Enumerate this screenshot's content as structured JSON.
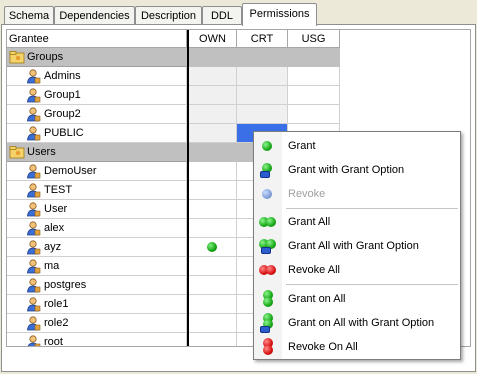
{
  "tabs": [
    {
      "label": "Schema",
      "active": false
    },
    {
      "label": "Dependencies",
      "active": false
    },
    {
      "label": "Description",
      "active": false
    },
    {
      "label": "DDL",
      "active": false
    },
    {
      "label": "Permissions",
      "active": true
    }
  ],
  "grid": {
    "columns": {
      "grantee": "Grantee",
      "own": "OWN",
      "crt": "CRT",
      "usg": "USG"
    },
    "groups_header": "Groups",
    "groups": [
      "Admins",
      "Group1",
      "Group2",
      "PUBLIC"
    ],
    "users_header": "Users",
    "users": [
      "DemoUser",
      "TEST",
      "User",
      "alex",
      "ayz",
      "ma",
      "postgres",
      "role1",
      "role2",
      "root"
    ],
    "granted_own_user": "ayz",
    "selected_cell": "PUBLIC / CRT"
  },
  "context_menu": {
    "items": [
      {
        "label": "Grant",
        "icon": "grant-icon",
        "enabled": true
      },
      {
        "label": "Grant with Grant Option",
        "icon": "grant-with-option-icon",
        "enabled": true
      },
      {
        "label": "Revoke",
        "icon": "revoke-icon",
        "enabled": false
      },
      {
        "label": "Grant All",
        "icon": "grant-all-icon",
        "enabled": true
      },
      {
        "label": "Grant All with Grant Option",
        "icon": "grant-all-with-option-icon",
        "enabled": true
      },
      {
        "label": "Revoke All",
        "icon": "revoke-all-icon",
        "enabled": true
      },
      {
        "label": "Grant on All",
        "icon": "grant-on-all-icon",
        "enabled": true
      },
      {
        "label": "Grant on All with Grant Option",
        "icon": "grant-on-all-with-option-icon",
        "enabled": true
      },
      {
        "label": "Revoke On All",
        "icon": "revoke-on-all-icon",
        "enabled": true
      }
    ]
  },
  "colors": {
    "selection": "#3a6fe8",
    "group_row": "#c0c0c0",
    "grant_green": "#17a817",
    "revoke_red": "#d81010"
  }
}
